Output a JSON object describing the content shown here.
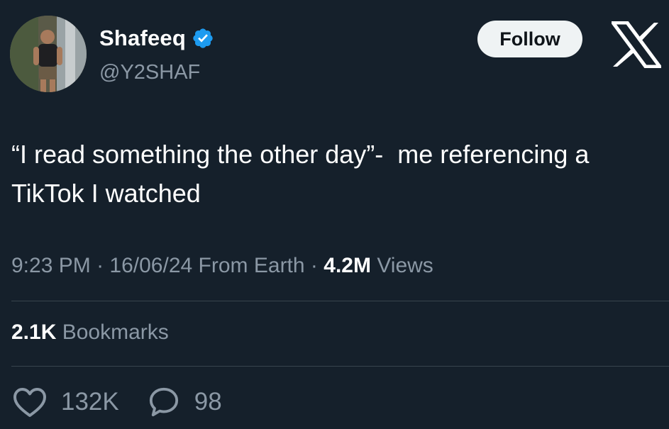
{
  "author": {
    "display_name": "Shafeeq",
    "handle": "@Y2SHAF",
    "verified": true
  },
  "follow_button": {
    "label": "Follow"
  },
  "tweet": {
    "text": "“I read something the other day”-  me referencing a TikTok I watched",
    "time": "9:23 PM",
    "date": "16/06/24",
    "source": "From Earth",
    "views_count": "4.2M",
    "views_label": "Views",
    "separator": "·"
  },
  "bookmarks": {
    "count": "2.1K",
    "label": "Bookmarks"
  },
  "actions": {
    "likes": "132K",
    "replies": "98"
  },
  "icons": {
    "brand": "x-logo-icon",
    "verified": "verified-badge-icon",
    "like": "heart-icon",
    "reply": "speech-bubble-icon"
  },
  "colors": {
    "background": "#15202b",
    "text_primary": "#ffffff",
    "text_secondary": "#8b98a5",
    "verified_blue": "#1d9bf0",
    "follow_bg": "#eff3f4",
    "divider": "#38444d"
  }
}
